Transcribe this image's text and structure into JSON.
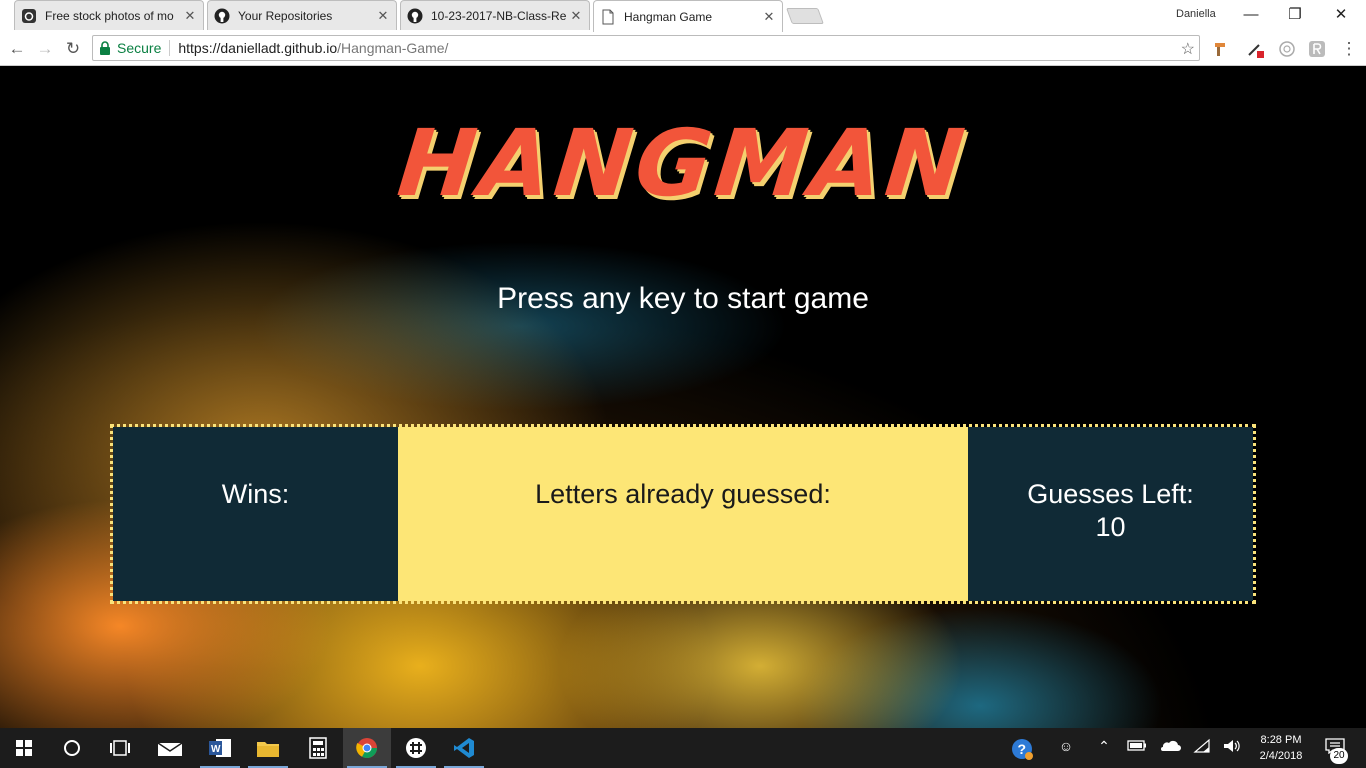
{
  "browser": {
    "tabs": [
      {
        "title": "Free stock photos of mo",
        "icon": "camera-icon"
      },
      {
        "title": "Your Repositories",
        "icon": "github-icon"
      },
      {
        "title": "10-23-2017-NB-Class-Re",
        "icon": "github-icon"
      },
      {
        "title": "Hangman Game",
        "icon": "page-icon"
      }
    ],
    "tab_close": "✕",
    "profile_name": "Daniella",
    "secure_label": "Secure",
    "url_host": "https://danielladt.github.io",
    "url_path": "/Hangman-Game/"
  },
  "page": {
    "title": "HANGMAN",
    "prompt": "Press any key to start game",
    "wins_label": "Wins:",
    "wins_value": "",
    "letters_label": "Letters already guessed:",
    "letters_value": "",
    "guesses_label": "Guesses Left:",
    "guesses_value": "10"
  },
  "taskbar": {
    "time": "8:28 PM",
    "date": "2/4/2018",
    "notification_count": "20"
  },
  "colors": {
    "title_red": "#f2553a",
    "title_shadow": "#f4d06f",
    "panel_dark": "#102a36",
    "panel_light": "#fde676",
    "border_dots": "#fae37a"
  }
}
